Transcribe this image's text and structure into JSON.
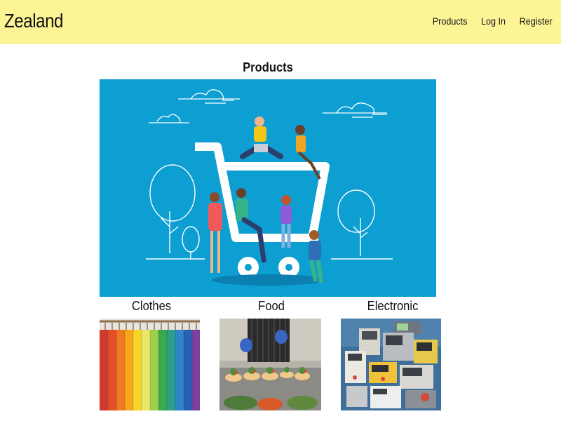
{
  "navbar": {
    "brand": "Zealand",
    "links": [
      {
        "label": "Products"
      },
      {
        "label": "Log In"
      },
      {
        "label": "Register"
      }
    ],
    "background": "#fdf496"
  },
  "main": {
    "title": "Products",
    "hero_background": "#0d9ed2",
    "categories": [
      {
        "label": "Clothes",
        "image_icon": "clothes-rack-image"
      },
      {
        "label": "Food",
        "image_icon": "food-plates-image"
      },
      {
        "label": "Electronic",
        "image_icon": "electronic-devices-image"
      }
    ]
  }
}
